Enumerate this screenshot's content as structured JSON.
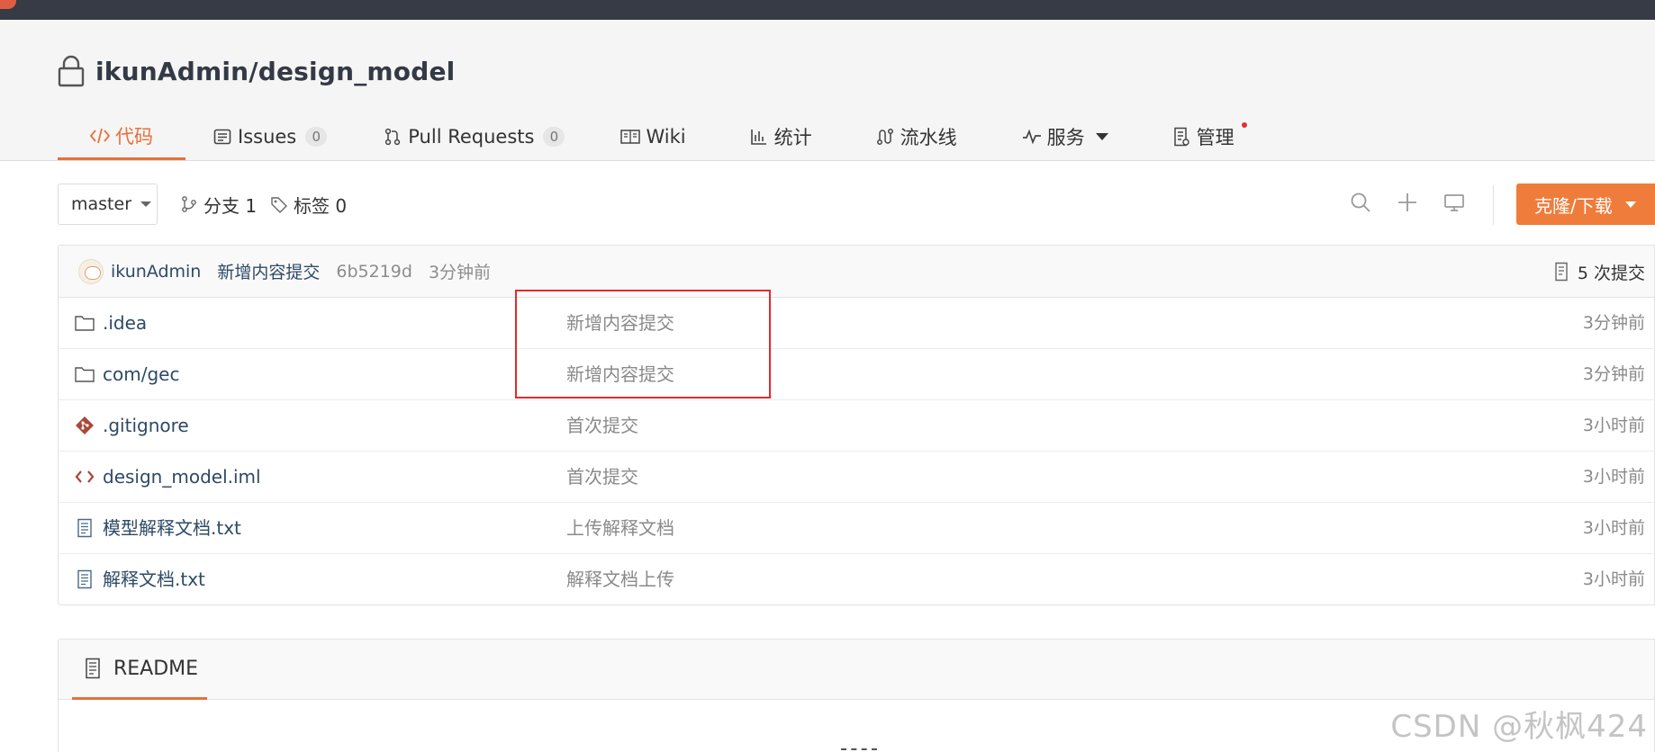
{
  "repo": {
    "owner_and_name": "ikunAdmin/design_model"
  },
  "tabs": [
    {
      "label": "代码",
      "icon": "code-icon",
      "active": true
    },
    {
      "label": "Issues",
      "icon": "issues-icon",
      "count": "0"
    },
    {
      "label": "Pull Requests",
      "icon": "pull-request-icon",
      "count": "0"
    },
    {
      "label": "Wiki",
      "icon": "book-icon"
    },
    {
      "label": "统计",
      "icon": "bar-chart-icon"
    },
    {
      "label": "流水线",
      "icon": "pipeline-icon"
    },
    {
      "label": "服务",
      "icon": "pulse-icon",
      "dropdown": true
    },
    {
      "label": "管理",
      "icon": "settings-doc-icon",
      "notification_dot": true
    }
  ],
  "toolbar": {
    "branch": "master",
    "branches_label": "分支 1",
    "tags_label": "标签 0",
    "clone_label": "克隆/下载"
  },
  "last_commit": {
    "author": "ikunAdmin",
    "message": "新增内容提交",
    "sha": "6b5219d",
    "time": "3分钟前",
    "count_label": "5 次提交"
  },
  "files": [
    {
      "name": ".idea",
      "type": "folder",
      "message": "新增内容提交",
      "time": "3分钟前"
    },
    {
      "name": "com/gec",
      "type": "folder",
      "message": "新增内容提交",
      "time": "3分钟前"
    },
    {
      "name": ".gitignore",
      "type": "git",
      "message": "首次提交",
      "time": "3小时前"
    },
    {
      "name": "design_model.iml",
      "type": "code",
      "message": "首次提交",
      "time": "3小时前"
    },
    {
      "name": "模型解释文档.txt",
      "type": "text",
      "message": "上传解释文档",
      "time": "3小时前"
    },
    {
      "name": "解释文档.txt",
      "type": "text",
      "message": "解释文档上传",
      "time": "3小时前"
    }
  ],
  "readme": {
    "tab_label": "README"
  },
  "watermark": "CSDN @秋枫424",
  "colors": {
    "accent": "#e8703a",
    "topbar": "#363b45",
    "link": "#2e4a66",
    "annotation": "#e12b2b"
  }
}
